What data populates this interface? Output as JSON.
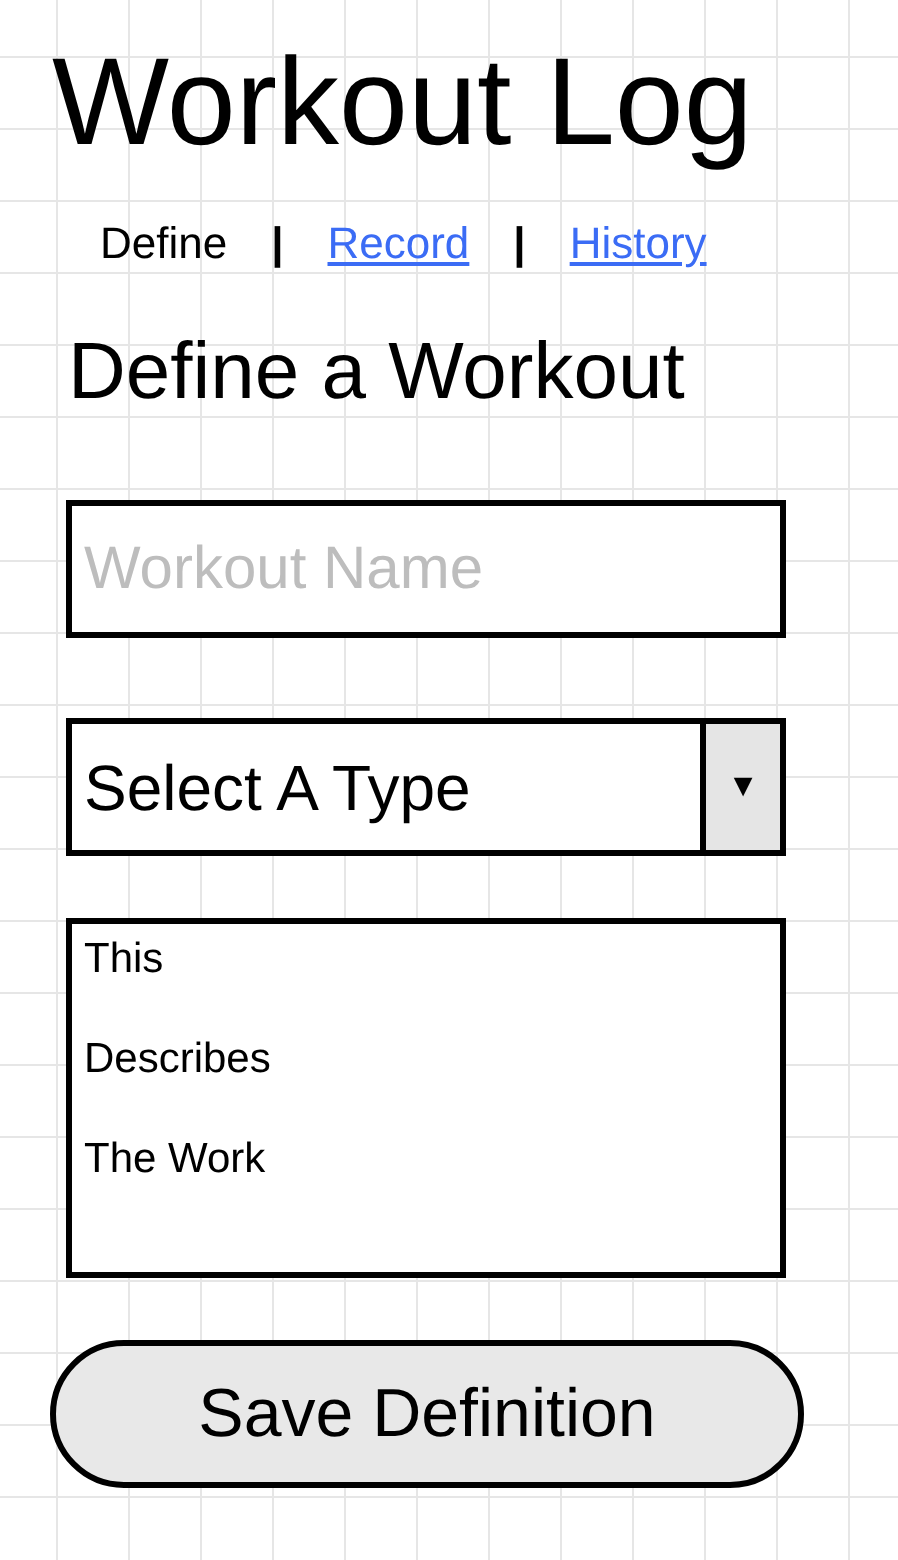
{
  "title": "Workout Log",
  "tabs": [
    {
      "label": "Define",
      "selected": true
    },
    {
      "label": "Record",
      "selected": false
    },
    {
      "label": "History",
      "selected": false
    }
  ],
  "separators": [
    "|",
    "|"
  ],
  "heading": "Define a Workout",
  "name_field": {
    "placeholder": "Workout Name"
  },
  "type_select": {
    "value": "Select A Type",
    "arrow": "▼"
  },
  "description": {
    "lines": [
      "This",
      "Describes",
      "The Work"
    ]
  },
  "save_button": "Save Definition"
}
